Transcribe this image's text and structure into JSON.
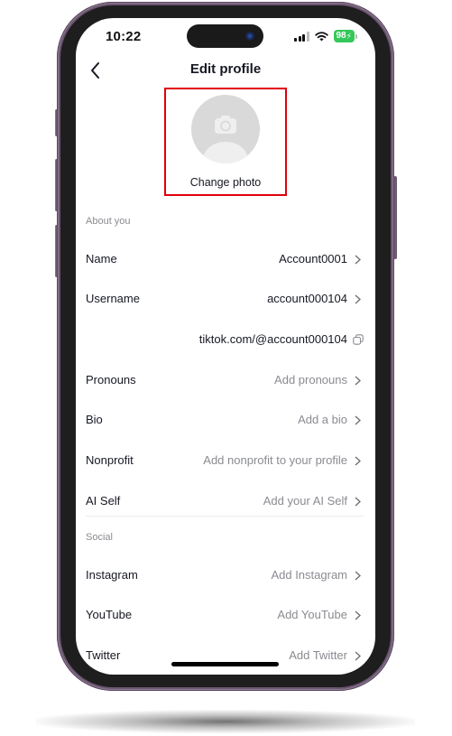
{
  "status_bar": {
    "time": "10:22",
    "battery": "98",
    "signal_icon": "cellular-signal-icon",
    "wifi_icon": "wifi-icon",
    "battery_icon": "battery-charging-icon"
  },
  "header": {
    "title": "Edit profile",
    "back_icon": "chevron-left-icon"
  },
  "profile_photo": {
    "label": "Change photo",
    "icon": "camera-icon",
    "highlight_color": "#e0000b"
  },
  "sections": {
    "about": {
      "label": "About you",
      "rows": [
        {
          "label": "Name",
          "value": "Account0001",
          "placeholder": false
        },
        {
          "label": "Username",
          "value": "account000104",
          "placeholder": false
        },
        {
          "label": "",
          "value": "tiktok.com/@account000104",
          "placeholder": false
        },
        {
          "label": "Pronouns",
          "value": "Add pronouns",
          "placeholder": true
        },
        {
          "label": "Bio",
          "value": "Add a bio",
          "placeholder": true
        },
        {
          "label": "Nonprofit",
          "value": "Add nonprofit to your profile",
          "placeholder": true
        },
        {
          "label": "AI Self",
          "value": "Add your AI Self",
          "placeholder": true
        }
      ]
    },
    "social": {
      "label": "Social",
      "rows": [
        {
          "label": "Instagram",
          "value": "Add Instagram",
          "placeholder": true
        },
        {
          "label": "YouTube",
          "value": "Add YouTube",
          "placeholder": true
        },
        {
          "label": "Twitter",
          "value": "Add Twitter",
          "placeholder": true
        }
      ]
    }
  },
  "colors": {
    "frame": "#6b5570",
    "bezel": "#1f1e1e",
    "text_primary": "#161823",
    "text_secondary": "#8a8b91",
    "battery": "#34c759"
  }
}
